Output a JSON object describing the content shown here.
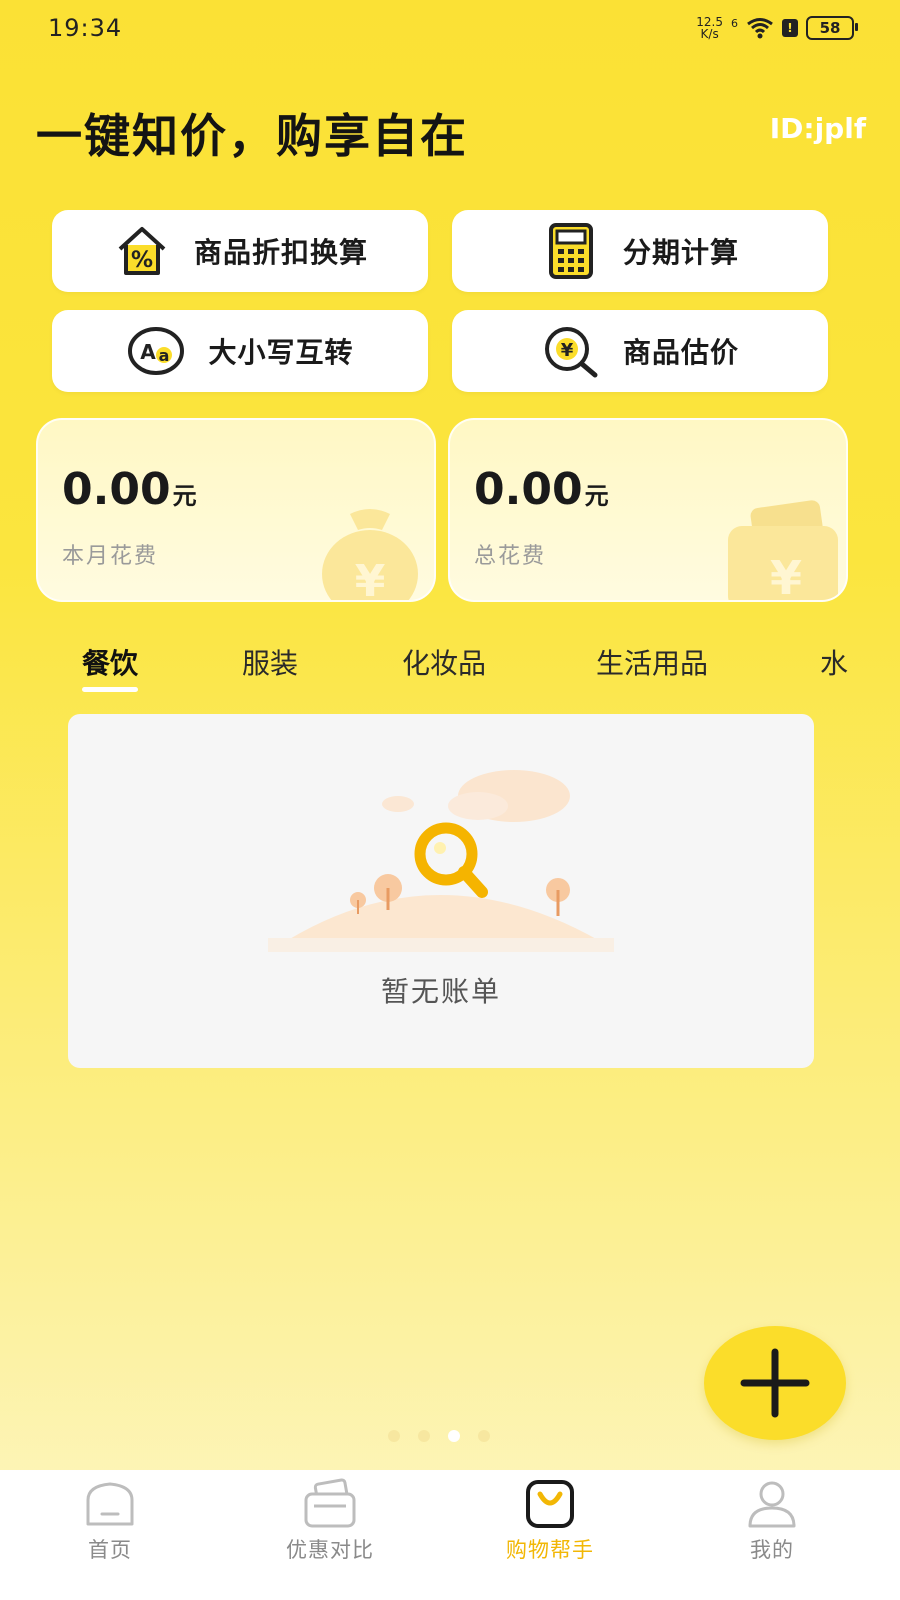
{
  "status_bar": {
    "time": "19:34",
    "net_speed_value": "12.5",
    "net_speed_unit": "K/s",
    "signal_label": "6",
    "battery": "58",
    "alert_badge": "!"
  },
  "header": {
    "headline": "一键知价，购享自在",
    "user_id": "ID:jplf"
  },
  "tools": [
    {
      "label": "商品折扣换算",
      "icon": "discount-house-icon"
    },
    {
      "label": "分期计算",
      "icon": "calculator-icon"
    },
    {
      "label": "大小写互转",
      "icon": "case-convert-icon"
    },
    {
      "label": "商品估价",
      "icon": "yuan-search-icon"
    }
  ],
  "stats": [
    {
      "amount": "0.00",
      "unit": "元",
      "caption": "本月花费",
      "icon": "money-bag-icon"
    },
    {
      "amount": "0.00",
      "unit": "元",
      "caption": "总花费",
      "icon": "wallet-icon"
    }
  ],
  "categories": [
    "餐饮",
    "服装",
    "化妆品",
    "生活用品",
    "水"
  ],
  "active_category": "餐饮",
  "empty_state": {
    "message": "暂无账单",
    "illustration": "search-hill-illustration"
  },
  "pager": {
    "count": 4,
    "active_index": 2
  },
  "fab": {
    "icon": "plus-icon"
  },
  "nav": [
    {
      "label": "首页",
      "icon": "home-icon"
    },
    {
      "label": "优惠对比",
      "icon": "wallet-compare-icon"
    },
    {
      "label": "购物帮手",
      "icon": "shopping-bag-icon"
    },
    {
      "label": "我的",
      "icon": "profile-icon"
    }
  ],
  "active_nav": "购物帮手",
  "colors": {
    "background_top": "#FBE135",
    "background_bottom": "#FDF6C7",
    "accent": "#F2B705",
    "fab": "#FBDD2A",
    "card": "#FFFFFF"
  }
}
